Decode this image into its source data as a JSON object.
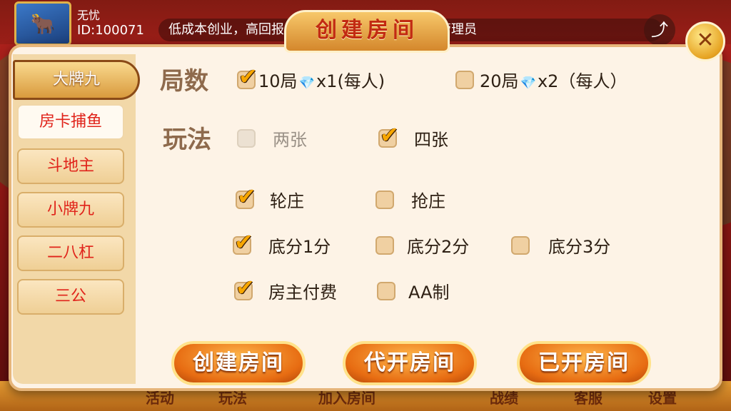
{
  "user": {
    "name": "无忧",
    "id_text": "ID:100071"
  },
  "marquee": {
    "text": "低成本创业，高回报…开发，快速搭建，请联系管理员"
  },
  "bottom_nav": [
    "活动",
    "玩法",
    "加入房间",
    "战绩",
    "客服",
    "设置"
  ],
  "dialog": {
    "title": "创建房间",
    "close_icon": "close-icon"
  },
  "games": [
    {
      "label": "大牌九",
      "state": "active"
    },
    {
      "label": "房卡捕鱼",
      "state": "highlight"
    },
    {
      "label": "斗地主",
      "state": "normal"
    },
    {
      "label": "小牌九",
      "state": "normal"
    },
    {
      "label": "二八杠",
      "state": "normal"
    },
    {
      "label": "三公",
      "state": "normal"
    }
  ],
  "rounds": {
    "label": "局数",
    "opt1": {
      "count": "10局",
      "cost": "x1(每人)",
      "checked": true
    },
    "opt2": {
      "count": "20局",
      "cost": "x2（每人）",
      "checked": false
    }
  },
  "play": {
    "label": "玩法",
    "opt1": {
      "text": "两张",
      "checked": false,
      "disabled": true
    },
    "opt2": {
      "text": "四张",
      "checked": true
    }
  },
  "banker": {
    "opt1": {
      "text": "轮庄",
      "checked": true
    },
    "opt2": {
      "text": "抢庄",
      "checked": false
    }
  },
  "base_score": {
    "opt1": {
      "text": "底分1分",
      "checked": true
    },
    "opt2": {
      "text": "底分2分",
      "checked": false
    },
    "opt3": {
      "text": "底分3分",
      "checked": false
    }
  },
  "payment": {
    "opt1": {
      "text": "房主付费",
      "checked": true
    },
    "opt2": {
      "text": "AA制",
      "checked": false
    }
  },
  "actions": {
    "create": "创建房间",
    "proxy_open": "代开房间",
    "opened": "已开房间"
  }
}
